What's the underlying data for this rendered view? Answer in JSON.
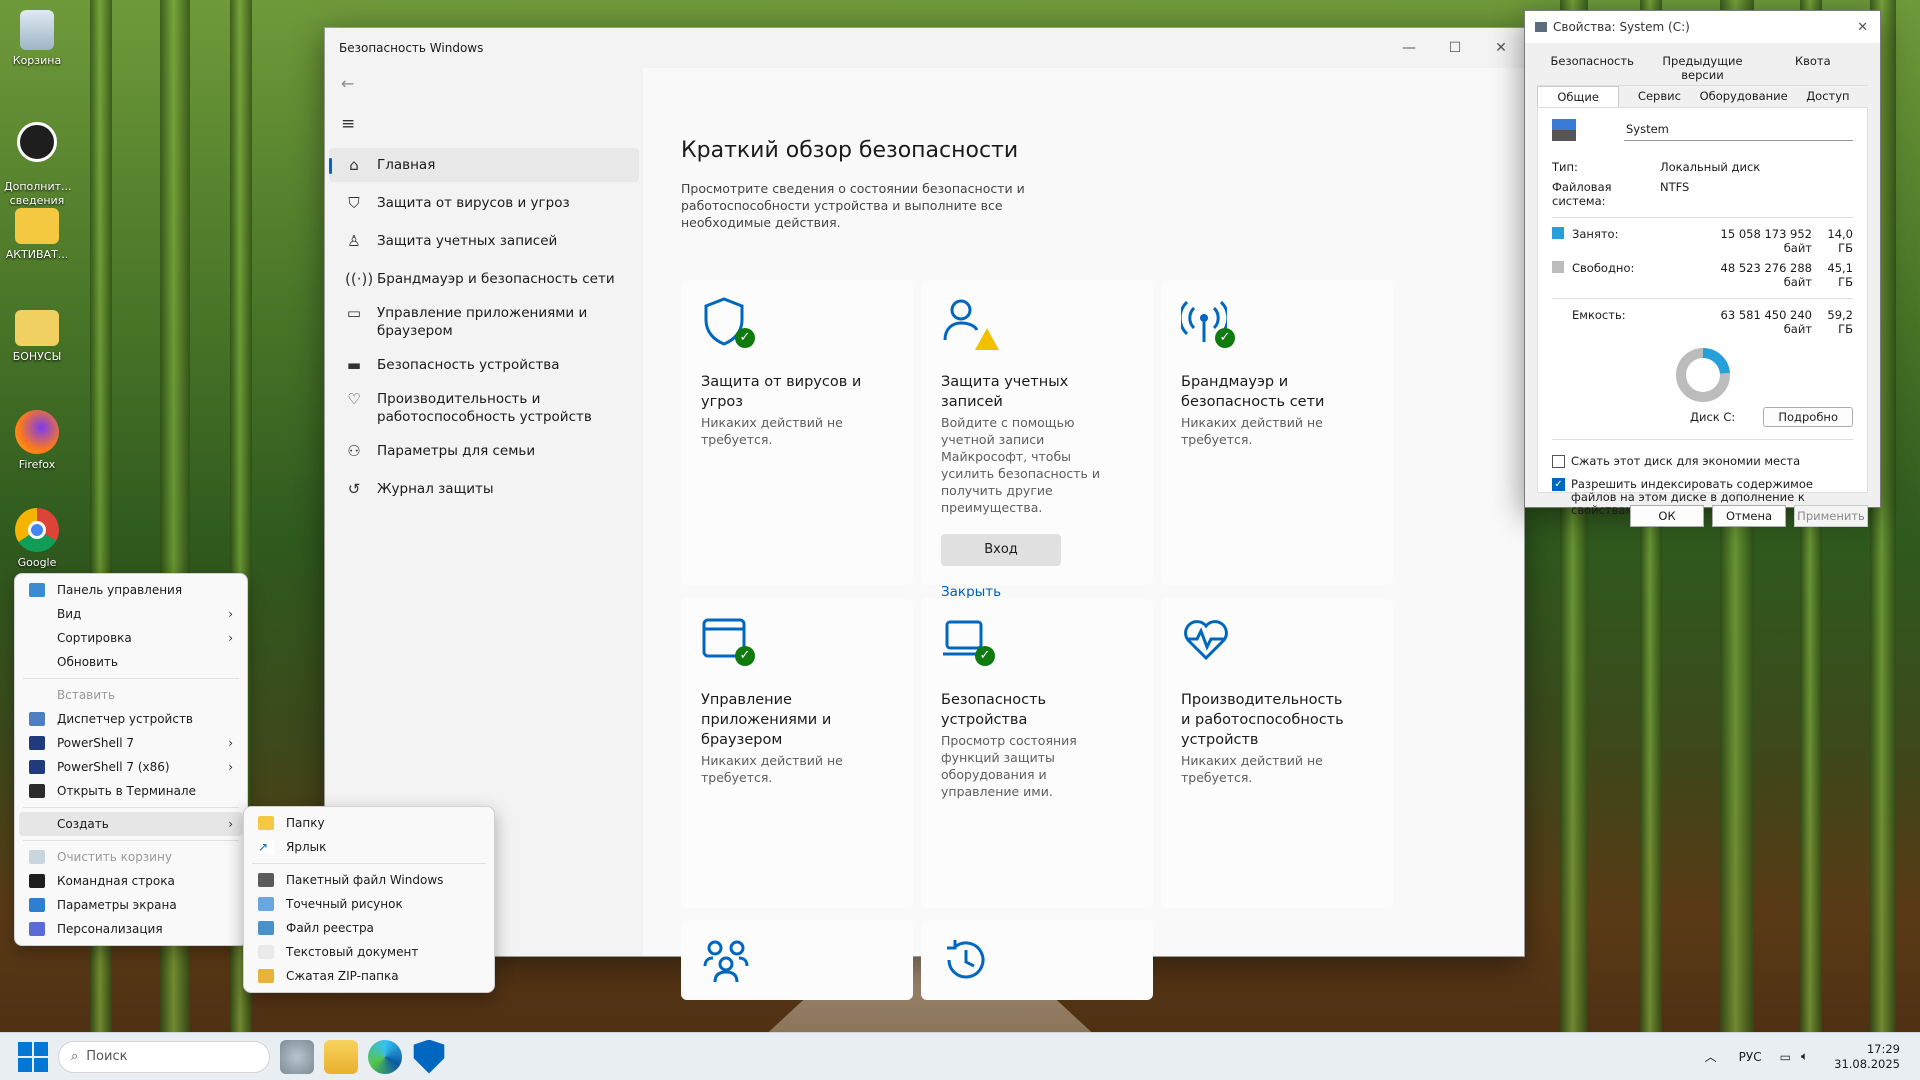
{
  "desktop": {
    "icons": [
      {
        "label": "Корзина"
      },
      {
        "label": "Дополнит...\nсведения ..."
      },
      {
        "label": "АКТИВАТ..."
      },
      {
        "label": "БОНУСЫ"
      },
      {
        "label": "Firefox"
      },
      {
        "label": "Google"
      }
    ]
  },
  "security": {
    "window_title": "Безопасность Windows",
    "nav": [
      {
        "icon": "home-icon",
        "label": "Главная"
      },
      {
        "icon": "shield-icon",
        "label": "Защита от вирусов и угроз"
      },
      {
        "icon": "person-icon",
        "label": "Защита учетных записей"
      },
      {
        "icon": "antenna-icon",
        "label": "Брандмауэр и безопасность сети"
      },
      {
        "icon": "app-browser-icon",
        "label": "Управление приложениями и браузером"
      },
      {
        "icon": "laptop-icon",
        "label": "Безопасность устройства"
      },
      {
        "icon": "heart-pulse-icon",
        "label": "Производительность и работоспособность устройств"
      },
      {
        "icon": "family-icon",
        "label": "Параметры для семьи"
      },
      {
        "icon": "history-icon",
        "label": "Журнал защиты"
      }
    ],
    "heading": "Краткий обзор безопасности",
    "intro": "Просмотрите сведения о состоянии безопасности и работоспособности устройства и выполните все необходимые действия.",
    "cards": [
      {
        "title": "Защита от вирусов и угроз",
        "status": "Никаких действий не требуется."
      },
      {
        "title": "Защита учетных записей",
        "status": "Войдите с помощью учетной записи Майкрософт, чтобы усилить безопасность и получить другие преимущества.",
        "button": "Вход",
        "link": "Закрыть"
      },
      {
        "title": "Брандмауэр и безопасность сети",
        "status": "Никаких действий не требуется."
      },
      {
        "title": "Управление приложениями и браузером",
        "status": "Никаких действий не требуется."
      },
      {
        "title": "Безопасность устройства",
        "status": "Просмотр состояния функций защиты оборудования и управление ими."
      },
      {
        "title": "Производительность и работоспособность устройств",
        "status": "Никаких действий не требуется."
      }
    ]
  },
  "props": {
    "title": "Свойства: System (C:)",
    "tabs_top": [
      "Безопасность",
      "Предыдущие версии",
      "Квота"
    ],
    "tabs_bottom": [
      "Общие",
      "Сервис",
      "Оборудование",
      "Доступ"
    ],
    "name_value": "System",
    "type_label": "Тип:",
    "type_value": "Локальный диск",
    "fs_label": "Файловая система:",
    "fs_value": "NTFS",
    "used_label": "Занято:",
    "used_bytes": "15 058 173 952 байт",
    "used_gb": "14,0 ГБ",
    "free_label": "Свободно:",
    "free_bytes": "48 523 276 288 байт",
    "free_gb": "45,1 ГБ",
    "cap_label": "Емкость:",
    "cap_bytes": "63 581 450 240 байт",
    "cap_gb": "59,2 ГБ",
    "used_fraction": 0.237,
    "disk_label": "Диск C:",
    "details_button": "Подробно",
    "compress_label": "Сжать этот диск для экономии места",
    "index_label": "Разрешить индексировать содержимое файлов на этом диске в дополнение к свойствам файла",
    "compress_checked": false,
    "index_checked": true,
    "ok": "ОК",
    "cancel": "Отмена",
    "apply": "Применить",
    "colors": {
      "used": "#26a0da",
      "free": "#bcbcbc"
    }
  },
  "context_menu": {
    "items": [
      {
        "label": "Панель управления",
        "icon": "control-panel-icon"
      },
      {
        "label": "Вид",
        "submenu": true
      },
      {
        "label": "Сортировка",
        "submenu": true
      },
      {
        "label": "Обновить"
      },
      {
        "sep": true
      },
      {
        "label": "Вставить",
        "disabled": true
      },
      {
        "label": "Диспетчер устройств",
        "icon": "device-manager-icon"
      },
      {
        "label": "PowerShell 7",
        "icon": "powershell-icon",
        "submenu": true
      },
      {
        "label": "PowerShell 7 (x86)",
        "icon": "powershell-icon",
        "submenu": true
      },
      {
        "label": "Открыть в Терминале",
        "icon": "terminal-icon"
      },
      {
        "sep": true
      },
      {
        "label": "Создать",
        "submenu": true,
        "highlighted": true
      },
      {
        "sep": true
      },
      {
        "label": "Очистить корзину",
        "icon": "recycle-icon",
        "disabled": true
      },
      {
        "label": "Командная строка",
        "icon": "cmd-icon"
      },
      {
        "label": "Параметры экрана",
        "icon": "display-icon"
      },
      {
        "label": "Персонализация",
        "icon": "personalize-icon"
      }
    ],
    "submenu": [
      {
        "label": "Папку",
        "icon": "folder-icon"
      },
      {
        "label": "Ярлык",
        "icon": "shortcut-icon"
      },
      {
        "sep": true
      },
      {
        "label": "Пакетный файл Windows",
        "icon": "batch-file-icon"
      },
      {
        "label": "Точечный рисунок",
        "icon": "bitmap-icon"
      },
      {
        "label": "Файл реестра",
        "icon": "registry-icon"
      },
      {
        "label": "Текстовый документ",
        "icon": "text-doc-icon"
      },
      {
        "label": "Сжатая ZIP-папка",
        "icon": "zip-folder-icon"
      }
    ]
  },
  "taskbar": {
    "search_placeholder": "Поиск",
    "lang": "РУС",
    "time": "17:29",
    "date": "31.08.2025"
  }
}
